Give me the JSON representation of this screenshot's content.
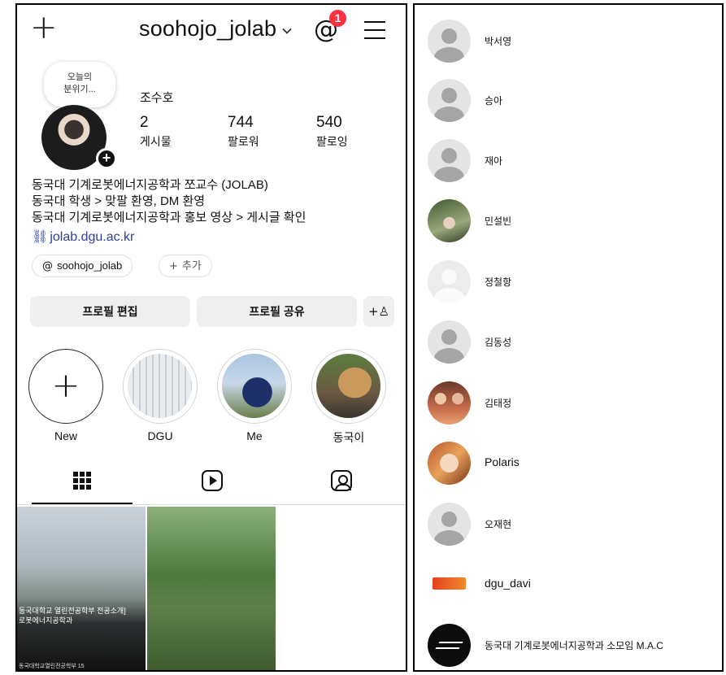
{
  "profile": {
    "username": "soohojo_jolab",
    "notification_count": "1",
    "note": [
      "오늘의",
      "분위기..."
    ],
    "full_name": "조수호",
    "stats": [
      {
        "value": "2",
        "label": "게시물"
      },
      {
        "value": "744",
        "label": "팔로워"
      },
      {
        "value": "540",
        "label": "팔로잉"
      }
    ],
    "bio": [
      "동국대 기계로봇에너지공학과 쪼교수 (JOLAB)",
      "동국대 학생 > 맞팔 환영, DM 환영",
      "동국대 기계로봇에너지공학과 홍보 영상 > 게시글 확인"
    ],
    "link": "jolab.dgu.ac.kr",
    "threads_pill": "soohojo_jolab",
    "add_pill": "추가",
    "edit_button": "프로필 편집",
    "share_button": "프로필 공유"
  },
  "highlights": [
    {
      "label": "New"
    },
    {
      "label": "DGU"
    },
    {
      "label": "Me"
    },
    {
      "label": "동국이"
    }
  ],
  "posts": [
    {
      "text": [
        "동국대학교 열린전공학부 전공소개]",
        "로봇에너지공학과"
      ],
      "meta": "동국대학교열린전공학부 15"
    },
    {
      "text": [],
      "meta": ""
    }
  ],
  "following": [
    {
      "name": "박서영",
      "avatar": "default"
    },
    {
      "name": "승아",
      "avatar": "default"
    },
    {
      "name": "재아",
      "avatar": "default"
    },
    {
      "name": "민설빈",
      "avatar": "photo-forest"
    },
    {
      "name": "정철항",
      "avatar": "light"
    },
    {
      "name": "김동성",
      "avatar": "default"
    },
    {
      "name": "김태정",
      "avatar": "photo-food"
    },
    {
      "name": "Polaris",
      "avatar": "photo-art"
    },
    {
      "name": "오재현",
      "avatar": "default"
    },
    {
      "name": "dgu_davi",
      "avatar": "logo-davi"
    },
    {
      "name": "동국대 기계로봇에너지공학과 소모임 M.A.C",
      "avatar": "logo-mac"
    }
  ],
  "colors": {
    "badge": "#ff3040",
    "link": "#2f3f9e",
    "button_bg": "#efefef"
  },
  "icons": [
    "plus-icon",
    "chevron-down-icon",
    "threads-icon",
    "menu-icon",
    "link-icon",
    "add-person-icon",
    "grid-icon",
    "reels-icon",
    "tagged-icon"
  ]
}
